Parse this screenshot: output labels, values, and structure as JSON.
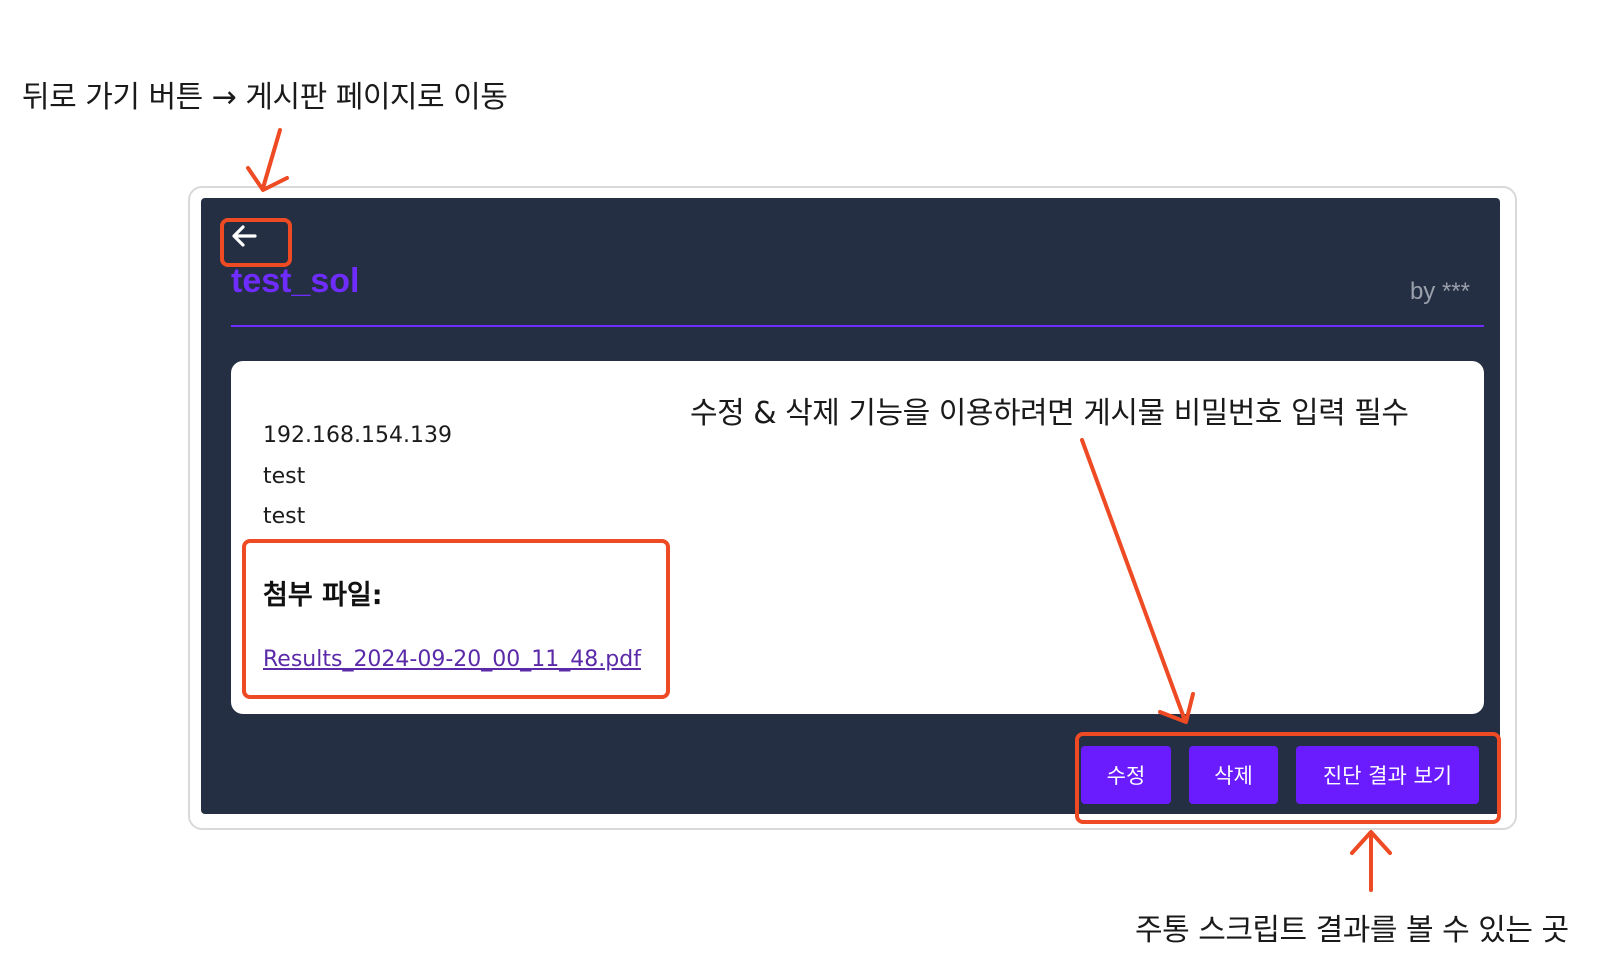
{
  "annotations": {
    "back_note": "뒤로 가기 버튼 → 게시판 페이지로 이동",
    "edit_delete_note": "수정 & 삭제 기능을 이용하려면 게시물 비밀번호 입력 필수",
    "results_note": "주통 스크립트 결과를 볼 수 있는 곳"
  },
  "post": {
    "title": "test_sol",
    "author": "by ***",
    "lines": [
      "192.168.154.139",
      "test",
      "test"
    ],
    "attachment_heading": "첨부 파일:",
    "attachment_link": "Results_2024-09-20_00_11_48.pdf"
  },
  "actions": {
    "edit_label": "수정",
    "delete_label": "삭제",
    "result_label": "진단 결과 보기"
  },
  "icons": {
    "back": "arrow-left-icon"
  },
  "colors": {
    "panel_bg": "#252f43",
    "accent": "#6f2cff",
    "button": "#6b1cff",
    "annotation": "#ee4a23"
  }
}
